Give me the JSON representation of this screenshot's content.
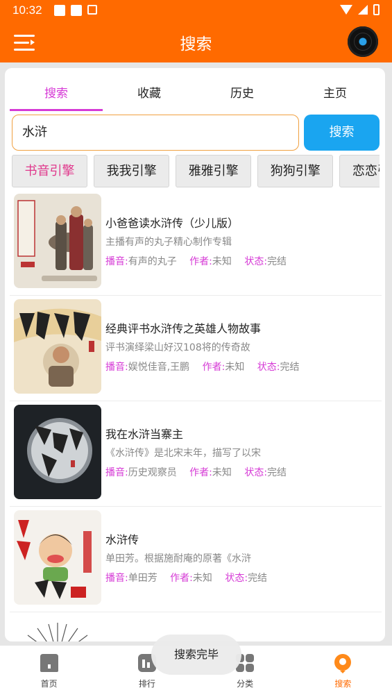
{
  "status_bar": {
    "time": "10:32"
  },
  "header": {
    "title": "搜索"
  },
  "tabs": [
    {
      "label": "搜索",
      "active": true
    },
    {
      "label": "收藏",
      "active": false
    },
    {
      "label": "历史",
      "active": false
    },
    {
      "label": "主页",
      "active": false
    }
  ],
  "search": {
    "value": "水浒",
    "button_label": "搜索"
  },
  "engines": [
    {
      "label": "书音引擎",
      "active": true
    },
    {
      "label": "我我引擎",
      "active": false
    },
    {
      "label": "雅雅引擎",
      "active": false
    },
    {
      "label": "狗狗引擎",
      "active": false
    },
    {
      "label": "恋恋引擎",
      "active": false
    }
  ],
  "meta_labels": {
    "narrator": "播音:",
    "author": "作者:",
    "status": "状态:"
  },
  "results": [
    {
      "title": "小爸爸读水浒传（少儿版）",
      "desc": "主播有声的丸子精心制作专辑",
      "narrator": "有声的丸子",
      "author": "未知",
      "status": "完结"
    },
    {
      "title": "经典评书水浒传之英雄人物故事",
      "desc": "评书演绎梁山好汉108将的传奇故",
      "narrator": "娱悦佳音,王鹏",
      "author": "未知",
      "status": "完结"
    },
    {
      "title": "我在水浒当寨主",
      "desc": "《水浒传》是北宋末年，描写了以宋",
      "narrator": "历史观察员",
      "author": "未知",
      "status": "完结"
    },
    {
      "title": "水浒传",
      "desc": "单田芳。根据施耐庵的原著《水浒",
      "narrator": "单田芳",
      "author": "未知",
      "status": "完结"
    },
    {
      "title": "",
      "desc": "",
      "narrator": "",
      "author": "",
      "status": ""
    }
  ],
  "toast": "搜索完毕",
  "bottom_nav": [
    {
      "label": "首页",
      "icon": "home-icon"
    },
    {
      "label": "排行",
      "icon": "ranking-icon"
    },
    {
      "label": "分类",
      "icon": "category-icon"
    },
    {
      "label": "搜索",
      "icon": "search-nav-icon",
      "active": true
    }
  ],
  "colors": {
    "accent": "#ff6a00",
    "tab_active": "#d63bd6",
    "button": "#1aa5f0",
    "engine_active": "#e0388c"
  }
}
